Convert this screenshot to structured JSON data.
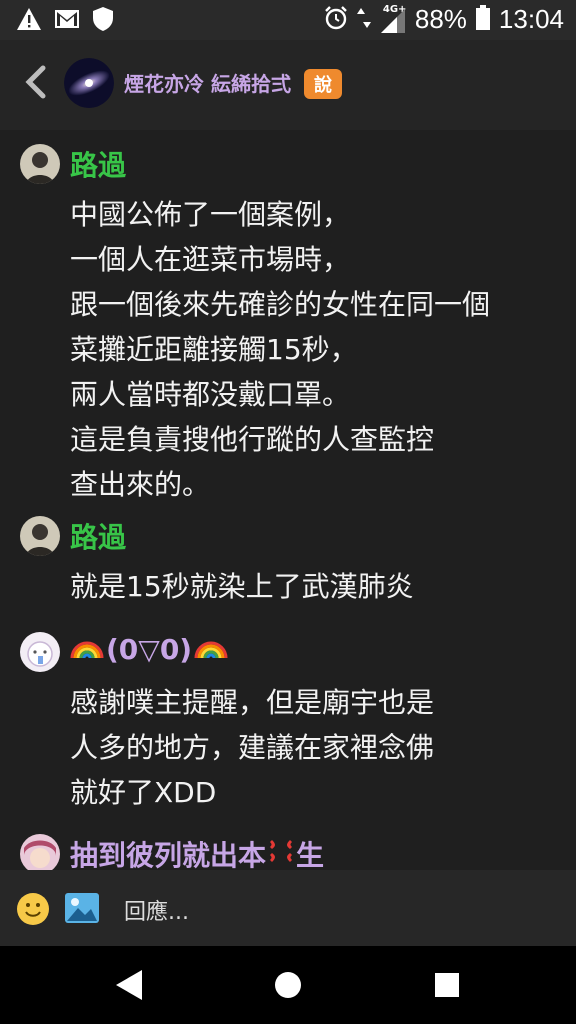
{
  "status_bar": {
    "icons_left": [
      "warning-icon",
      "gmail-icon",
      "shield-icon"
    ],
    "icons_right": [
      "alarm-icon",
      "data-arrows-icon",
      "signal-icon",
      "battery-icon"
    ],
    "network": "4G+",
    "battery": "88%",
    "time": "13:04"
  },
  "header": {
    "title": "煙花亦冷 紜絺拾弍",
    "badge": "說",
    "colors": {
      "title": "#c7a6e6",
      "badge": "#ef8a2e"
    }
  },
  "comments": [
    {
      "name": "路過",
      "name_color": "#38c548",
      "avatar_icon": "man-portrait-avatar",
      "body": "中國公佈了一個案例，\n一個人在逛菜市場時，\n跟一個後來先確診的女性在同一個\n菜攤近距離接觸15秒，\n兩人當時都没戴口罩。\n這是負責搜他行蹤的人查監控\n查出來的。"
    },
    {
      "name": "路過",
      "name_color": "#38c548",
      "avatar_icon": "man-portrait-avatar",
      "body": "就是15秒就染上了武漢肺炎"
    },
    {
      "name": "(0▽0)",
      "name_color": "#c7a6e6",
      "avatar_icon": "cute-character-avatar",
      "name_prefix_icon": "rainbow-emoji",
      "name_suffix_icon": "rainbow-emoji",
      "body": "感謝噗主提醒，但是廟宇也是\n人多的地方，建議在家裡念佛\n就好了XDD"
    },
    {
      "name_part1": "抽到彼列就出本",
      "name_part2": "生",
      "name_color": "#c7a6e6",
      "avatar_icon": "anime-avatar",
      "name_mid_icon": "anger-emoji"
    }
  ],
  "reply_bar": {
    "placeholder": "回應...",
    "emoji_icon": "smiley-icon",
    "image_icon": "image-icon"
  },
  "nav_bar": {
    "icons": [
      "back-triangle-icon",
      "home-circle-icon",
      "recents-square-icon"
    ]
  }
}
